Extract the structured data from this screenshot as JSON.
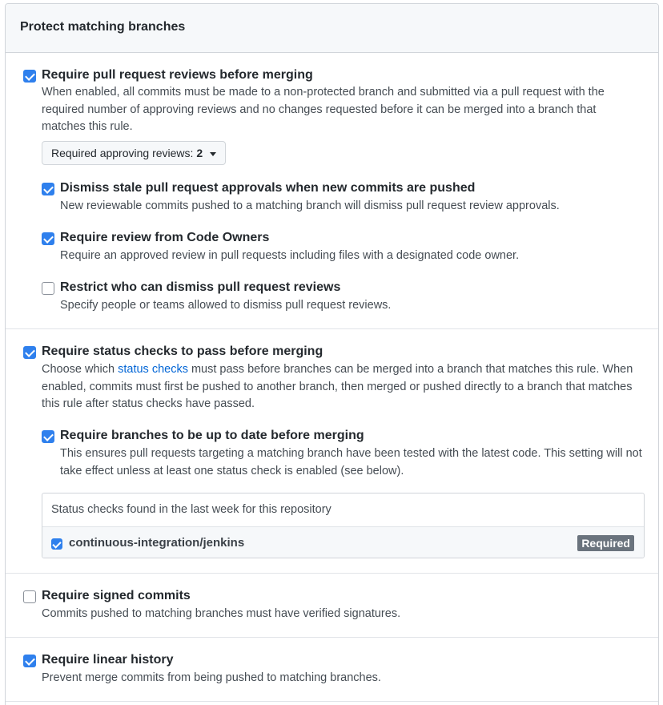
{
  "panel": {
    "title": "Protect matching branches"
  },
  "rules": {
    "pr_reviews": {
      "checked": true,
      "label": "Require pull request reviews before merging",
      "desc": "When enabled, all commits must be made to a non-protected branch and submitted via a pull request with the required number of approving reviews and no changes requested before it can be merged into a branch that matches this rule.",
      "approving_label": "Required approving reviews:",
      "approving_value": "2",
      "sub": {
        "dismiss_stale": {
          "checked": true,
          "label": "Dismiss stale pull request approvals when new commits are pushed",
          "desc": "New reviewable commits pushed to a matching branch will dismiss pull request review approvals."
        },
        "code_owners": {
          "checked": true,
          "label": "Require review from Code Owners",
          "desc": "Require an approved review in pull requests including files with a designated code owner."
        },
        "restrict_dismiss": {
          "checked": false,
          "label": "Restrict who can dismiss pull request reviews",
          "desc": "Specify people or teams allowed to dismiss pull request reviews."
        }
      }
    },
    "status_checks": {
      "checked": true,
      "label": "Require status checks to pass before merging",
      "desc_before": "Choose which ",
      "desc_link": "status checks",
      "desc_after": " must pass before branches can be merged into a branch that matches this rule. When enabled, commits must first be pushed to another branch, then merged or pushed directly to a branch that matches this rule after status checks have passed.",
      "sub": {
        "up_to_date": {
          "checked": true,
          "label": "Require branches to be up to date before merging",
          "desc": "This ensures pull requests targeting a matching branch have been tested with the latest code. This setting will not take effect unless at least one status check is enabled (see below)."
        }
      },
      "found_header": "Status checks found in the last week for this repository",
      "checks": [
        {
          "checked": true,
          "name": "continuous-integration/jenkins",
          "badge": "Required"
        }
      ]
    },
    "signed_commits": {
      "checked": false,
      "label": "Require signed commits",
      "desc": "Commits pushed to matching branches must have verified signatures."
    },
    "linear_history": {
      "checked": true,
      "label": "Require linear history",
      "desc": "Prevent merge commits from being pushed to matching branches."
    }
  },
  "colors": {
    "accent": "#2f80ed",
    "link": "#0366d6",
    "badge": "#6a737d"
  }
}
